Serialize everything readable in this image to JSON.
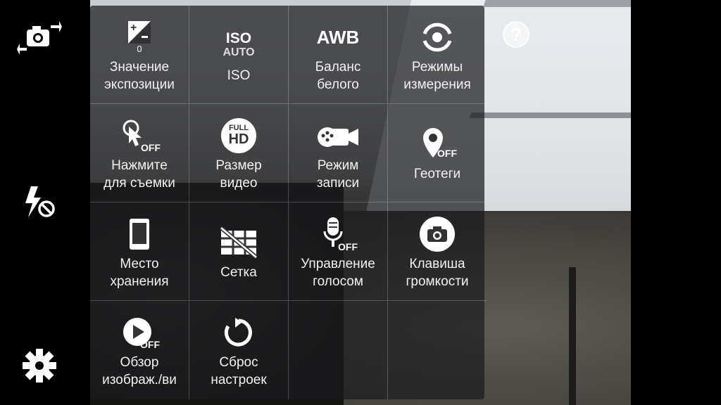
{
  "sidebar": {
    "switch_camera_icon": "camera-switch-icon",
    "flash_icon": "flash-off-icon",
    "settings_icon": "gear-icon"
  },
  "help": {
    "label": "?"
  },
  "menu": {
    "items": [
      {
        "label": "Значение\nэкспозиции",
        "icon": "exposure-icon",
        "icon_sub": "0"
      },
      {
        "label": "ISO",
        "icon": "iso-icon",
        "icon_top": "ISO",
        "icon_sub": "AUTO"
      },
      {
        "label": "Баланс\nбелого",
        "icon": "awb-icon",
        "icon_top": "AWB"
      },
      {
        "label": "Режимы\nизмерения",
        "icon": "metering-icon"
      },
      {
        "label": "Нажмите\nдля съемки",
        "icon": "tap-shot-icon",
        "icon_sub": "OFF"
      },
      {
        "label": "Размер\nвидео",
        "icon": "full-hd-icon",
        "icon_top": "FULL",
        "icon_sub": "HD"
      },
      {
        "label": "Режим\nзаписи",
        "icon": "recording-mode-icon"
      },
      {
        "label": "Геотеги",
        "icon": "geotag-icon",
        "icon_sub": "OFF"
      },
      {
        "label": "Место\nхранения",
        "icon": "storage-icon"
      },
      {
        "label": "Сетка",
        "icon": "grid-icon"
      },
      {
        "label": "Управление\nголосом",
        "icon": "voice-control-icon",
        "icon_sub": "OFF"
      },
      {
        "label": "Клавиша\nгромкости",
        "icon": "volume-key-camera-icon"
      },
      {
        "label": "Обзор\nизображ./ви",
        "icon": "review-icon",
        "icon_sub": "OFF"
      },
      {
        "label": "Сброс\nнастроек",
        "icon": "reset-icon"
      },
      {
        "label": "",
        "icon": ""
      },
      {
        "label": "",
        "icon": ""
      }
    ]
  }
}
